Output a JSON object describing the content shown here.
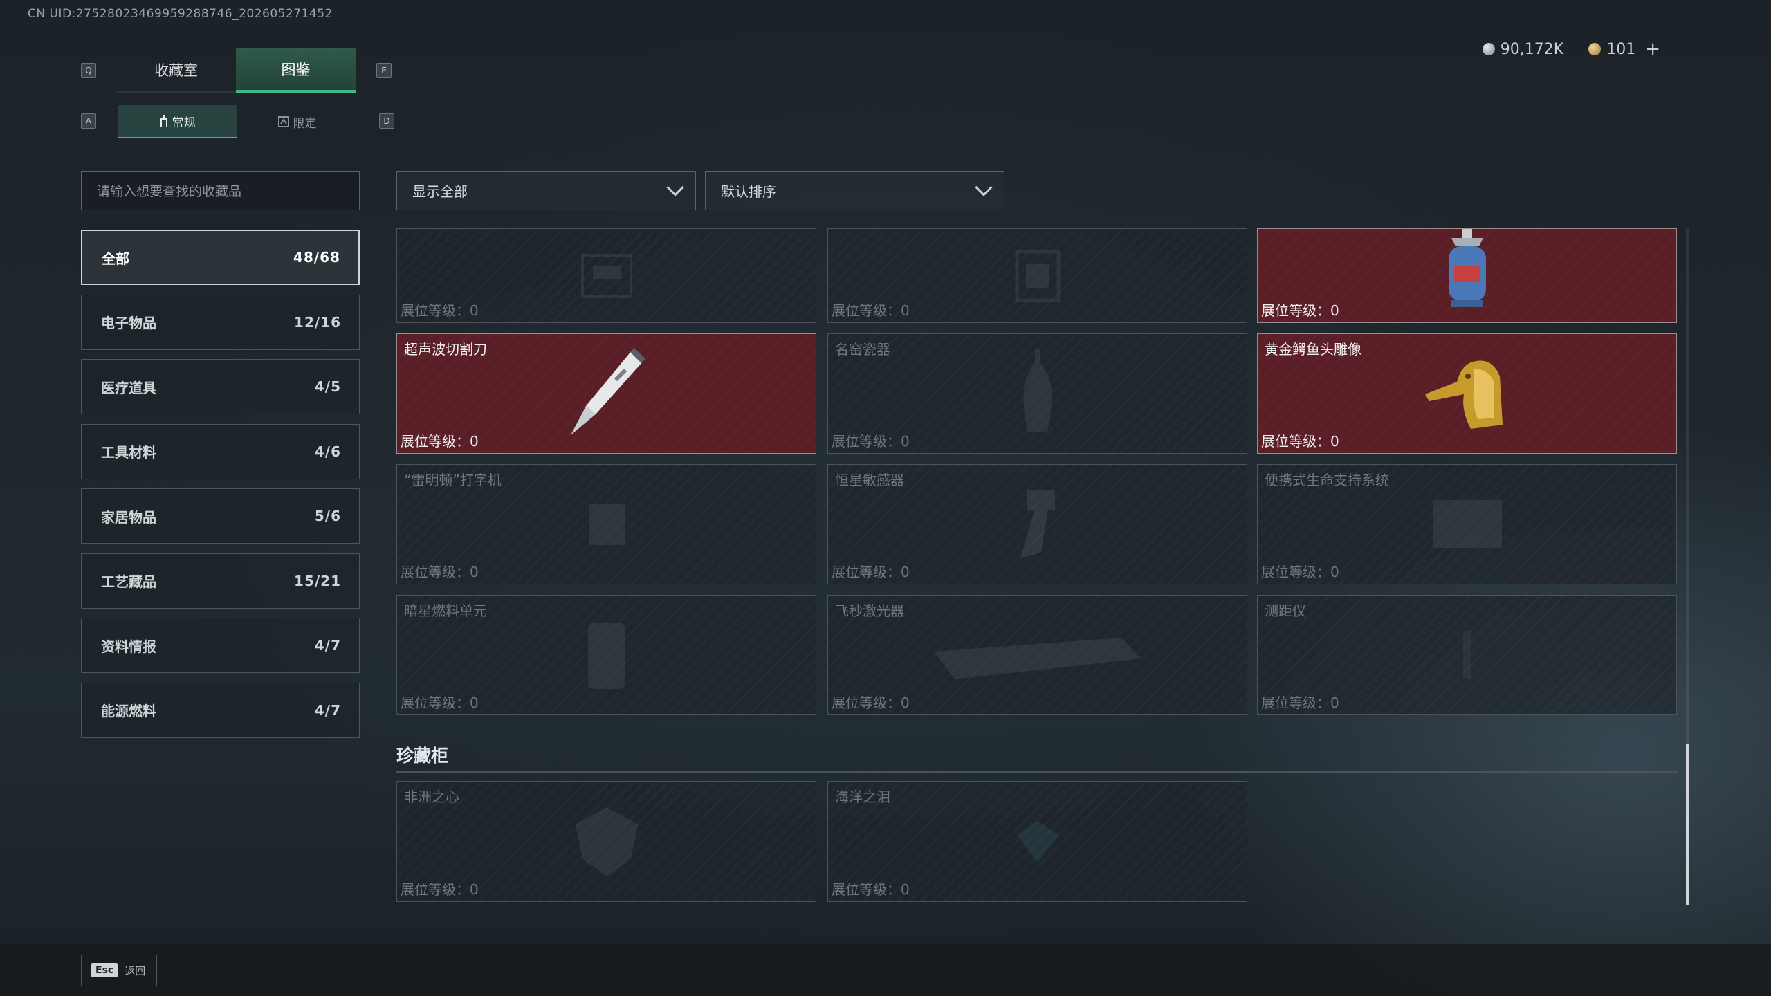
{
  "uid": "CN UID:2752802346995928874​6_202605271452",
  "currency": {
    "silver": "90,172K",
    "gold": "101",
    "add_label": "+"
  },
  "keys": {
    "prev_tab": "Q",
    "next_tab": "E",
    "prev_sub": "A",
    "next_sub": "D"
  },
  "tabs": [
    {
      "label": "收藏室"
    },
    {
      "label": "图鉴"
    }
  ],
  "subtabs": [
    {
      "label": "常规"
    },
    {
      "label": "限定"
    }
  ],
  "search": {
    "placeholder": "请输入想要查找的收藏品"
  },
  "filters": {
    "show": "显示全部",
    "sort": "默认排序"
  },
  "categories": [
    {
      "label": "全部",
      "count": "48/68"
    },
    {
      "label": "电子物品",
      "count": "12/16"
    },
    {
      "label": "医疗道具",
      "count": "4/5"
    },
    {
      "label": "工具材料",
      "count": "4/6"
    },
    {
      "label": "家居物品",
      "count": "5/6"
    },
    {
      "label": "工艺藏品",
      "count": "15/21"
    },
    {
      "label": "资料情报",
      "count": "4/7"
    },
    {
      "label": "能源燃料",
      "count": "4/7"
    }
  ],
  "level_label": "展位等级：0",
  "items": [
    {
      "name": "",
      "owned": false,
      "icon": "device-icon"
    },
    {
      "name": "",
      "owned": false,
      "icon": "box-icon"
    },
    {
      "name": "",
      "owned": true,
      "icon": "gas-canister-icon"
    },
    {
      "name": "超声波切割刀",
      "owned": true,
      "icon": "ultrasonic-knife-icon"
    },
    {
      "name": "名窑瓷器",
      "owned": false,
      "icon": "vase-icon"
    },
    {
      "name": "黄金鳄鱼头雕像",
      "owned": true,
      "icon": "golden-crocodile-icon"
    },
    {
      "name": "“雷明顿”打字机",
      "owned": false,
      "icon": "typewriter-icon"
    },
    {
      "name": "恒星敏感器",
      "owned": false,
      "icon": "star-sensor-icon"
    },
    {
      "name": "便携式生命支持系统",
      "owned": false,
      "icon": "life-support-icon"
    },
    {
      "name": "暗星燃料单元",
      "owned": false,
      "icon": "fuel-cell-icon"
    },
    {
      "name": "飞秒激光器",
      "owned": false,
      "icon": "laser-icon"
    },
    {
      "name": "测距仪",
      "owned": false,
      "icon": "rangefinder-icon"
    }
  ],
  "treasure": {
    "title": "珍藏柜",
    "items": [
      {
        "name": "非洲之心",
        "owned": false,
        "icon": "diamond-icon"
      },
      {
        "name": "海洋之泪",
        "owned": false,
        "icon": "gem-icon"
      }
    ]
  },
  "footer": {
    "esc_key": "Esc",
    "back_label": "返回"
  }
}
